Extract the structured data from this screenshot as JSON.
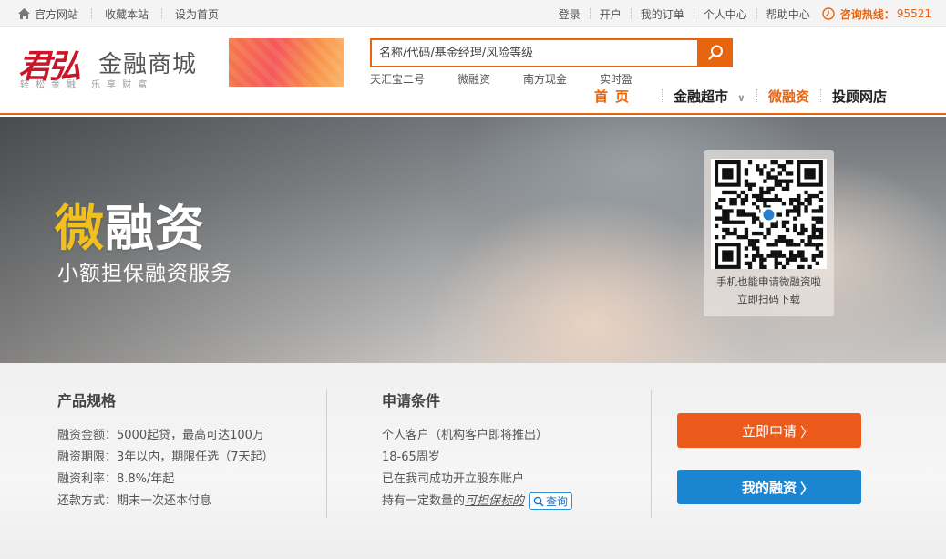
{
  "topbar": {
    "left_links": [
      "官方网站",
      "收藏本站",
      "设为首页"
    ],
    "right_links": [
      "登录",
      "开户",
      "我的订单",
      "个人中心",
      "帮助中心"
    ],
    "hotline_label": "咨询热线：",
    "hotline_number": "95521"
  },
  "header": {
    "logo_mark": "君弘",
    "logo_name": "金融商城",
    "logo_slogan": "轻松金融 乐享财富",
    "search_placeholder": "名称/代码/基金经理/风险等级",
    "hotwords": [
      "天汇宝二号",
      "微融资",
      "南方现金",
      "实时盈"
    ],
    "nav": {
      "home": "首页",
      "market": "金融超市",
      "micro": "微融资",
      "advisor": "投顾网店"
    }
  },
  "banner": {
    "title_accent": "微",
    "title_rest": "融资",
    "subtitle": "小额担保融资服务",
    "qr_caption_1": "手机也能申请微融资啦",
    "qr_caption_2": "立即扫码下载"
  },
  "spec": {
    "title": "产品规格",
    "lines": [
      "融资金额：5000起贷，最高可达100万",
      "融资期限：3年以内，期限任选（7天起）",
      "融资利率：8.8%/年起",
      "还款方式：期末一次还本付息"
    ]
  },
  "conditions": {
    "title": "申请条件",
    "lines": [
      "个人客户（机构客户即将推出）",
      "18-65周岁",
      "已在我司成功开立股东账户"
    ],
    "last_prefix": "持有一定数量的",
    "last_link": "可担保标的",
    "query_label": "查询"
  },
  "actions": {
    "apply_label": "立即申请",
    "my_label": "我的融资"
  },
  "colors": {
    "brand_orange": "#e8650f",
    "brand_red": "#c8162b",
    "apply": "#eb5a1a",
    "my": "#1a85d0",
    "accent_yellow": "#f2c01e"
  },
  "icons": [
    "home-icon",
    "clock-icon",
    "search-icon",
    "qr-code",
    "chevron-right-icon",
    "chevron-down-icon",
    "magnifier-icon"
  ]
}
